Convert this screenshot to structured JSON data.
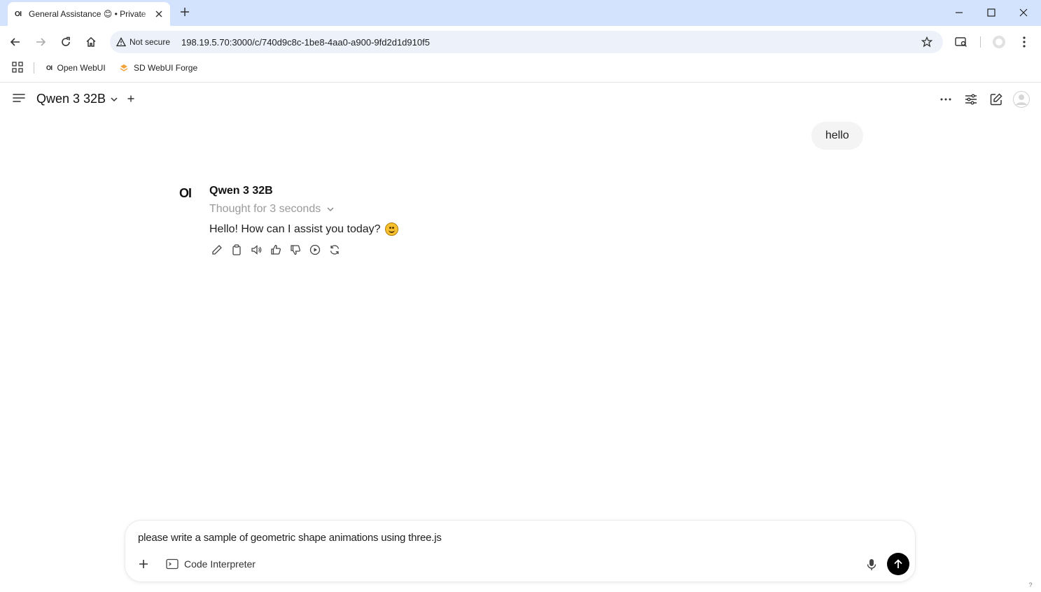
{
  "browser": {
    "tab": {
      "favicon": "OI",
      "title": "General Assistance 😊 • Private"
    },
    "address": {
      "security_label": "Not secure",
      "url": "198.19.5.70:3000/c/740d9c8c-1be8-4aa0-a900-9fd2d1d910f5"
    },
    "bookmarks": [
      {
        "label": "Open WebUI",
        "icon": "OI"
      },
      {
        "label": "SD WebUI Forge",
        "icon": "forge-icon"
      }
    ]
  },
  "header": {
    "model": "Qwen 3 32B"
  },
  "chat": {
    "user_message": "hello",
    "assistant": {
      "logo": "OI",
      "name": "Qwen 3 32B",
      "thought": "Thought for 3 seconds",
      "reply": "Hello! How can I assist you today?"
    }
  },
  "composer": {
    "prompt": "please write a sample of geometric shape animations using three.js",
    "tool_label": "Code Interpreter"
  },
  "help_label": "?",
  "colors": {
    "tabbar": "#d3e3fd",
    "omnibox": "#edf2fa",
    "send": "#000000"
  }
}
